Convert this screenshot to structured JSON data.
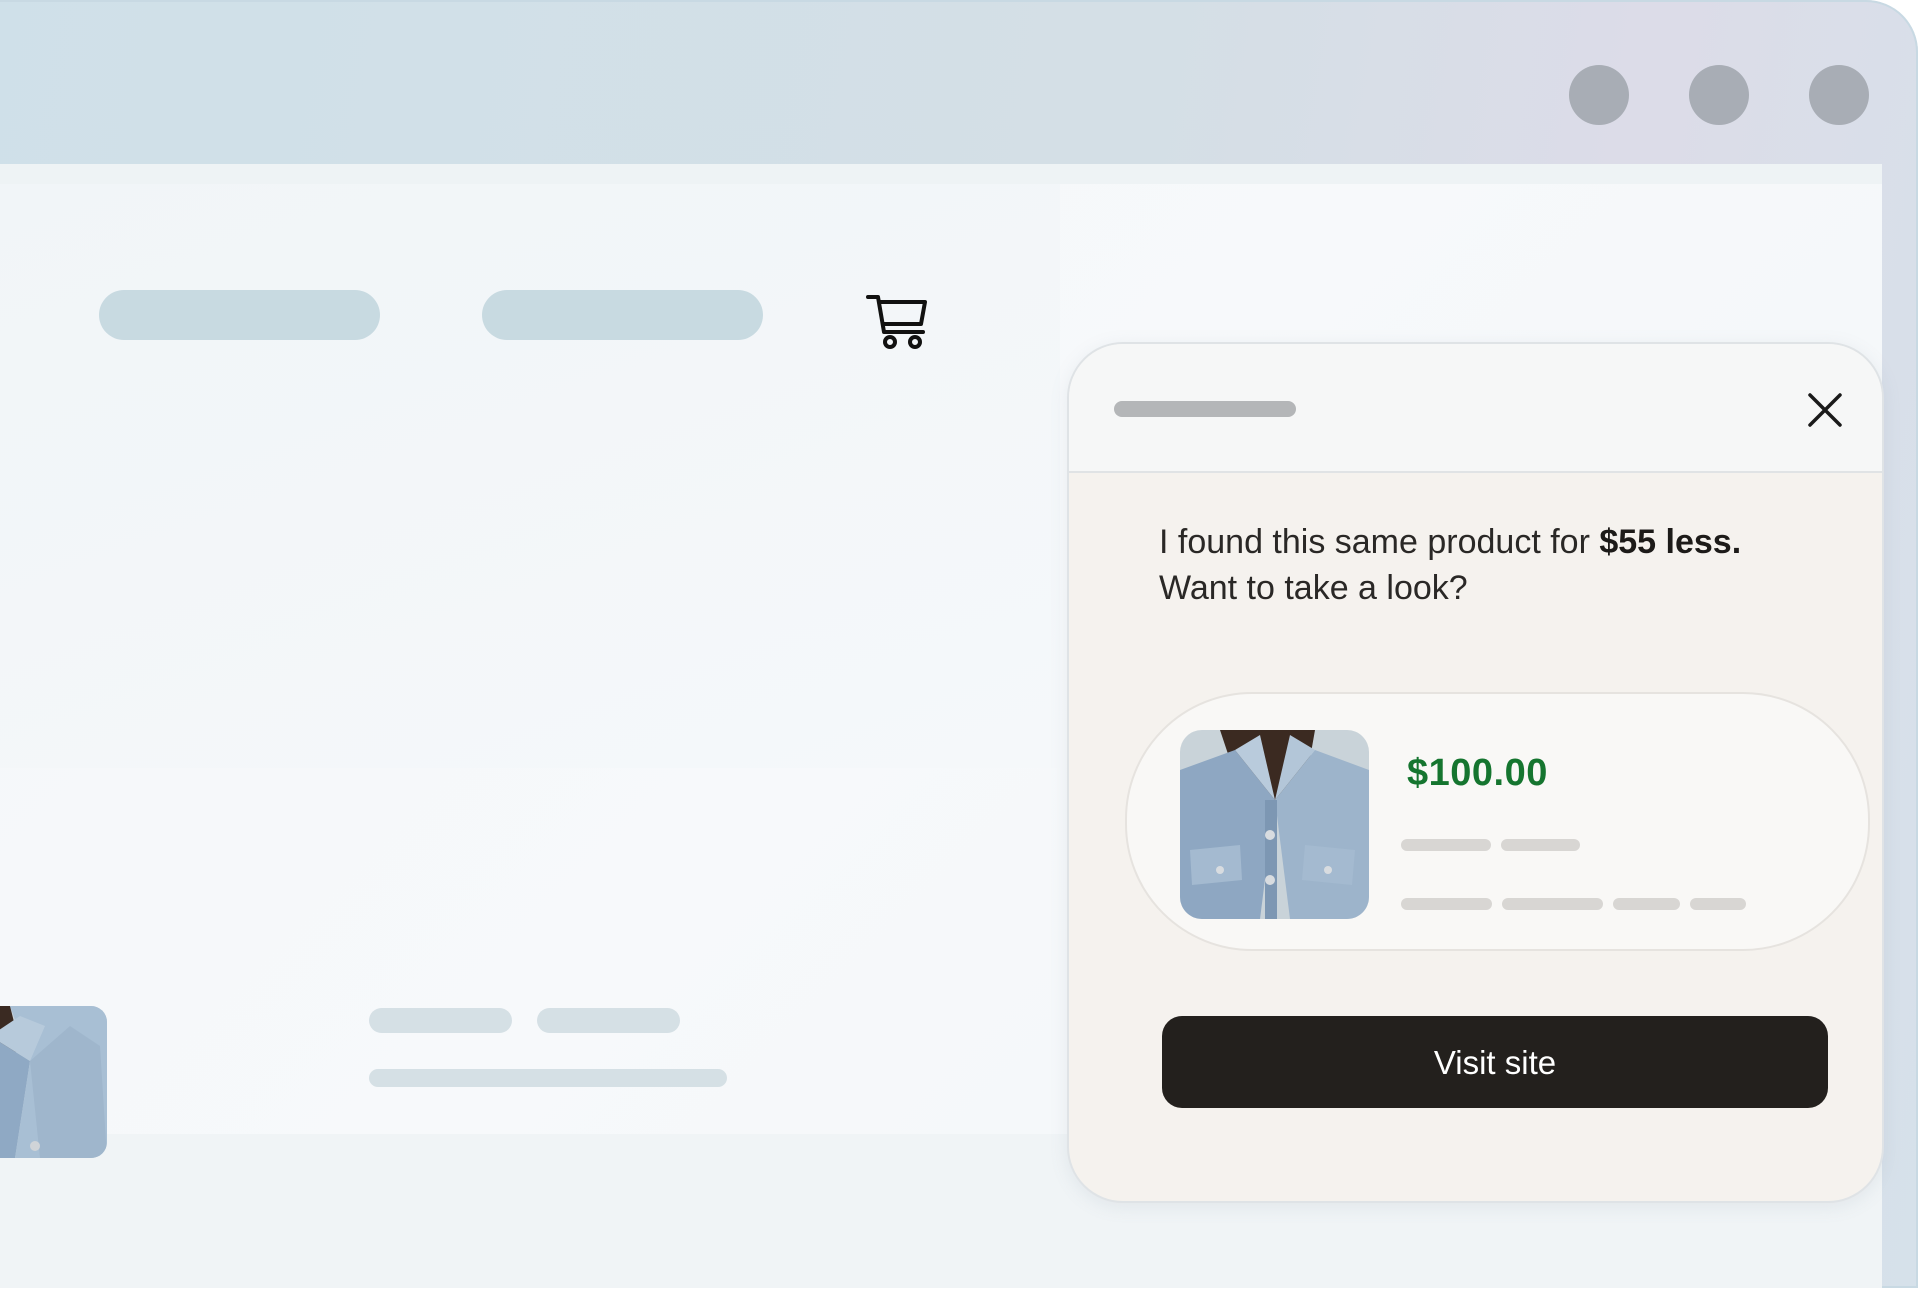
{
  "panel": {
    "message_prefix": "I found this same product for ",
    "message_bold": "$55 less.",
    "message_suffix": "Want to take a look?",
    "product": {
      "price": "$100.00",
      "image": "denim-jacket-photo"
    },
    "cta_label": "Visit site"
  },
  "icons": {
    "cart": "cart-icon",
    "profile": "profile-icon",
    "copilot": "copilot-icon",
    "close": "close-icon"
  },
  "colors": {
    "price_green": "#15752f",
    "button_dark": "#23201d",
    "skeleton": "#c8dae1",
    "window_button": "#a8adb5"
  }
}
